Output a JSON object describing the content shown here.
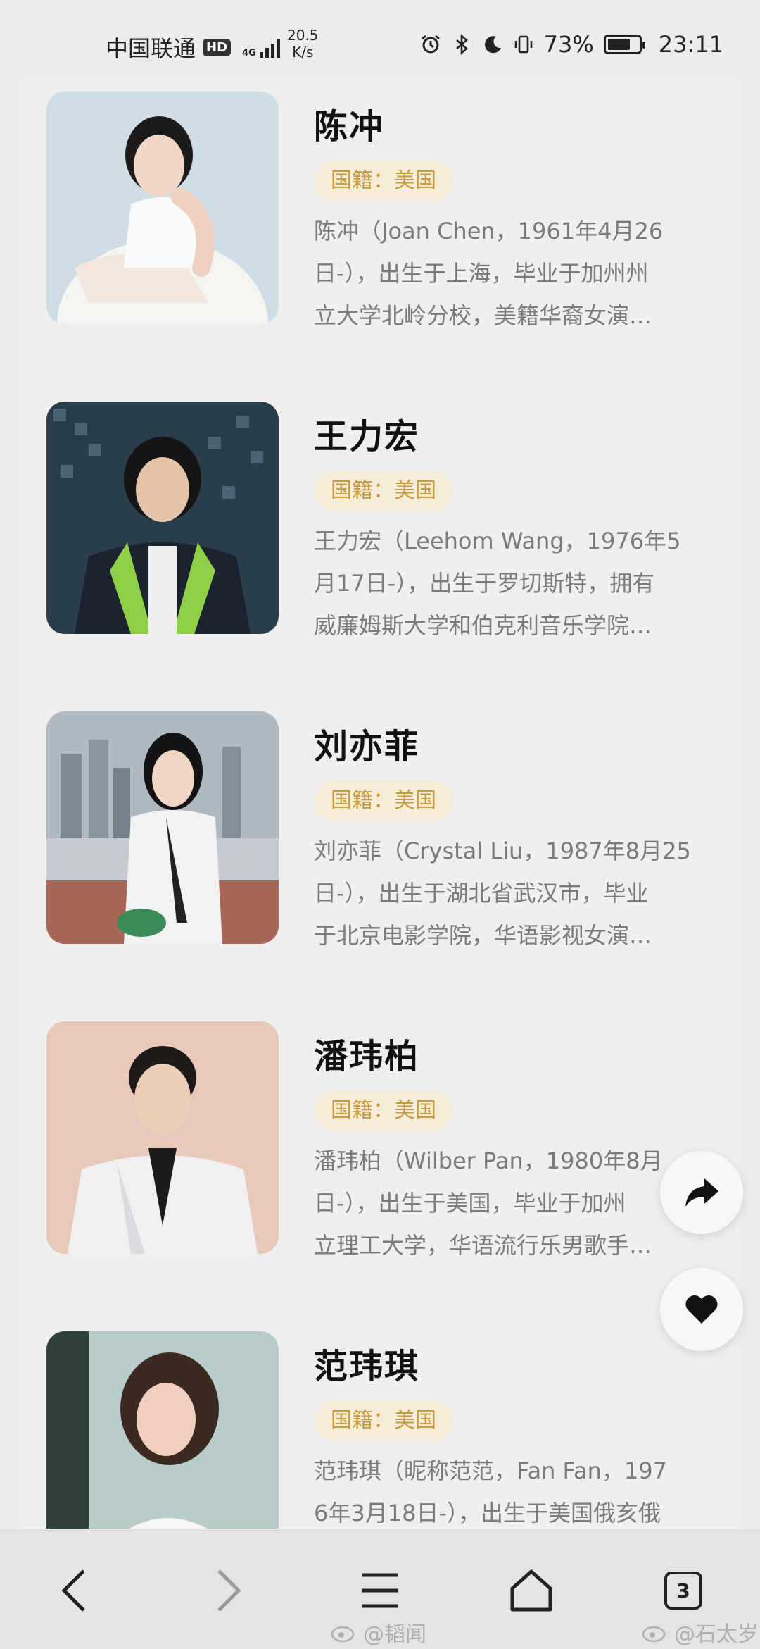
{
  "status_bar": {
    "carrier": "中国联通",
    "hd_badge": "HD",
    "network_type": "4G",
    "speed_value": "20.5",
    "speed_unit": "K/s",
    "battery_percent": "73%",
    "battery_level": 0.73,
    "time": "23:11"
  },
  "celebrities": [
    {
      "name": "陈冲",
      "nationality": "国籍：美国",
      "desc_lines": [
        "陈冲（Joan Chen，1961年4月26",
        "日-），出生于上海，毕业于加州州",
        "立大学北岭分校，美籍华裔女演…"
      ]
    },
    {
      "name": "王力宏",
      "nationality": "国籍：美国",
      "desc_lines": [
        "王力宏（Leehom Wang，1976年5",
        "月17日-），出生于罗切斯特，拥有",
        "威廉姆斯大学和伯克利音乐学院…"
      ]
    },
    {
      "name": "刘亦菲",
      "nationality": "国籍：美国",
      "desc_lines": [
        "刘亦菲（Crystal Liu，1987年8月25",
        "日-），出生于湖北省武汉市，毕业",
        "于北京电影学院，华语影视女演…"
      ]
    },
    {
      "name": "潘玮柏",
      "nationality": "国籍：美国",
      "desc_lines": [
        "潘玮柏（Wilber Pan，1980年8月",
        "日-），出生于美国，毕业于加州",
        "立理工大学，华语流行乐男歌手…"
      ]
    },
    {
      "name": "范玮琪",
      "nationality": "国籍：美国",
      "desc_lines": [
        "范玮琪（昵称范范，Fan Fan，197",
        "6年3月18日-），出生于美国俄亥俄",
        ""
      ]
    }
  ],
  "floating_buttons": {
    "share_icon": "share-arrow-icon",
    "like_icon": "heart-icon"
  },
  "bottom_nav": {
    "tab_count": "3"
  },
  "watermarks": {
    "left": "@韬闻",
    "right": "@石太岁"
  }
}
